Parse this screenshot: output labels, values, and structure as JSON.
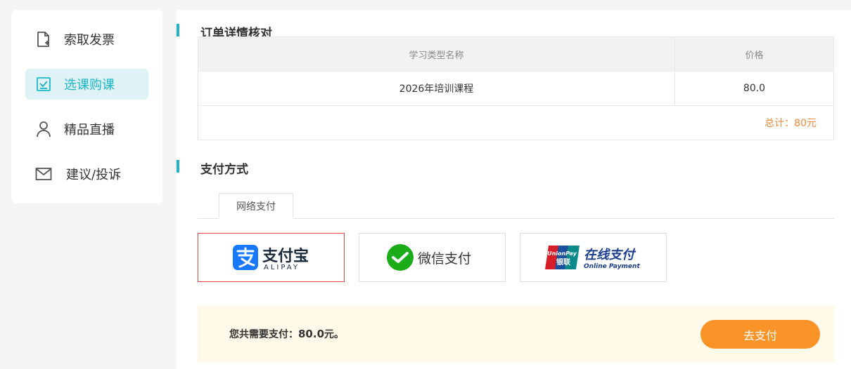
{
  "sidebar": {
    "items": [
      {
        "label": "索取发票",
        "icon": "document-plus-icon",
        "active": false
      },
      {
        "label": "选课购课",
        "icon": "checkbox-icon",
        "active": true
      },
      {
        "label": "精品直播",
        "icon": "user-icon",
        "active": false
      },
      {
        "label": "建议/投诉",
        "icon": "mail-icon",
        "active": false
      }
    ]
  },
  "order": {
    "title": "订单详情核对",
    "columns": [
      "学习类型名称",
      "价格"
    ],
    "rows": [
      [
        "2026年培训课程",
        "80.0"
      ]
    ],
    "total": "总计：80元"
  },
  "payment": {
    "title": "支付方式",
    "tabs": [
      "网络支付"
    ],
    "options": [
      {
        "name": "支付宝",
        "sub": "ALIPAY",
        "icon": "alipay-icon",
        "selected": true
      },
      {
        "name": "微信支付",
        "icon": "wechat-icon",
        "selected": false
      },
      {
        "name": "在线支付",
        "sub": "Online Payment",
        "badge_top": "UnionPay",
        "badge_bottom": "银联",
        "icon": "unionpay-icon",
        "selected": false
      }
    ]
  },
  "footer": {
    "prefix": "您共需要支付：",
    "amount": "80.0",
    "suffix": "元。",
    "button_label": "去支付"
  },
  "colors": {
    "accent": "#1db6c8",
    "orange": "#fa9428",
    "total": "#f08a3c",
    "selected_border": "#e0463c",
    "alipay": "#1677ff",
    "wechat": "#1aad19",
    "unionpay_navy": "#1c3f8f"
  }
}
